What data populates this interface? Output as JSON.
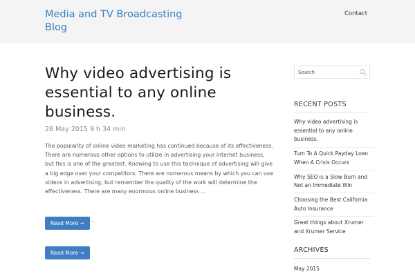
{
  "header": {
    "site_title": "Media and TV Broadcasting Blog",
    "nav_contact": "Contact"
  },
  "post": {
    "title": "Why video advertising is essential to any online business.",
    "meta": "28 May 2015 9 h 34 min",
    "excerpt": "The popularity of online video marketing has continued because of its effectiveness. There are numerous other options to utilize in advertising your internet business, but this is one of the greatest. Knowing to use this technique of advertising will give a big edge over your competitors. There are numerous means by which you can use videos in advertising, but remember the quality of the work will determine the effectiveness. There are many enormous online business …",
    "read_more_1": "Read More →",
    "read_more_2": "Read More →",
    "trailing_dots": "…"
  },
  "sidebar": {
    "search_placeholder": "Search",
    "search_icon": "search-icon",
    "recent_posts_title": "RECENT POSTS",
    "recent_posts": [
      "Why video advertising is essential to any online business.",
      "Turn To A Quick Payday Loan When A Crisis Occurs",
      "Why SEO is a Slow Burn and Not an Immediate Win",
      "Choosing the Best California Auto Insurance",
      "Great things about Xrumer and Xrumer Service"
    ],
    "archives_title": "ARCHIVES",
    "archives": [
      "May 2015"
    ]
  },
  "colors": {
    "header_bg": "#f4f4f4",
    "brand_blue": "#3a7dbf",
    "button_bg": "#3f7ec2"
  }
}
